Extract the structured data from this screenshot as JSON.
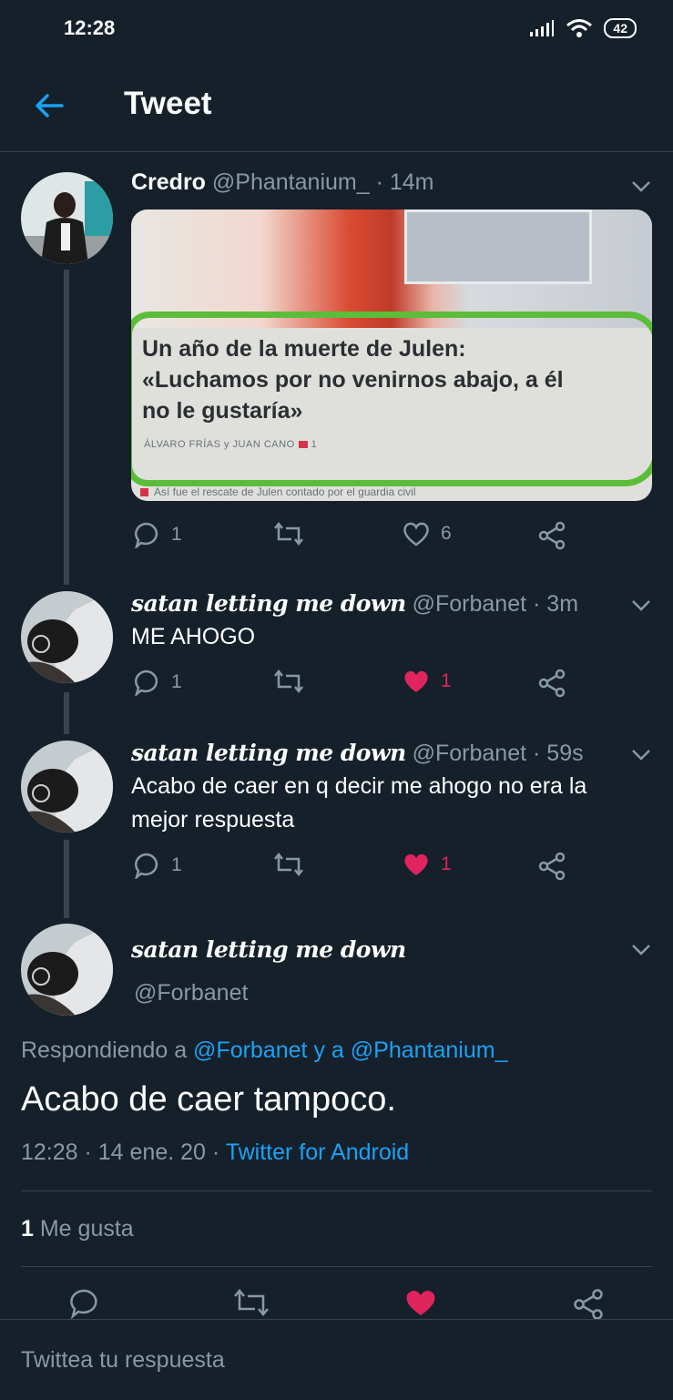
{
  "status_bar": {
    "time": "12:28",
    "battery": "42"
  },
  "header": {
    "title": "Tweet"
  },
  "thread": [
    {
      "name": "Credro",
      "handle": "@Phantanium_",
      "time": "· 14m",
      "image": {
        "headline_line1": "Un año de la muerte de Julen:",
        "headline_line2": "«Luchamos por no venirnos abajo, a él",
        "headline_line3": "no le gustaría»",
        "byline": "ÁLVARO FRÍAS y JUAN CANO",
        "byline_count": "1",
        "caption": "Así fue el rescate de Julen contado por el guardia civil"
      },
      "replies": "1",
      "likes": "6"
    },
    {
      "name": "satan letting me down",
      "handle": "@Forbanet",
      "time": "· 3m",
      "text": "ME AHOGO",
      "replies": "1",
      "likes": "1"
    },
    {
      "name": "satan letting me down",
      "handle": "@Forbanet",
      "time": "· 59s",
      "text_line1": "Acabo de caer en q decir me ahogo no era la",
      "text_line2": "mejor respuesta",
      "replies": "1",
      "likes": "1"
    }
  ],
  "main_tweet": {
    "name": "satan letting me down",
    "handle": "@Forbanet",
    "replying_prefix": "Respondiendo a",
    "replying_user1": "@Forbanet",
    "replying_mid": "y a",
    "replying_user2": "@Phantanium_",
    "text": "Acabo de caer tampoco.",
    "timestamp": "12:28 · 14 ene. 20 ·",
    "source": "Twitter for Android",
    "like_count": "1",
    "like_label": "Me gusta"
  },
  "reply_box": {
    "placeholder": "Twittea tu respuesta"
  },
  "colors": {
    "background": "#15202b",
    "accent": "#1da1f2",
    "like": "#e0245e",
    "muted": "#8899a6"
  }
}
